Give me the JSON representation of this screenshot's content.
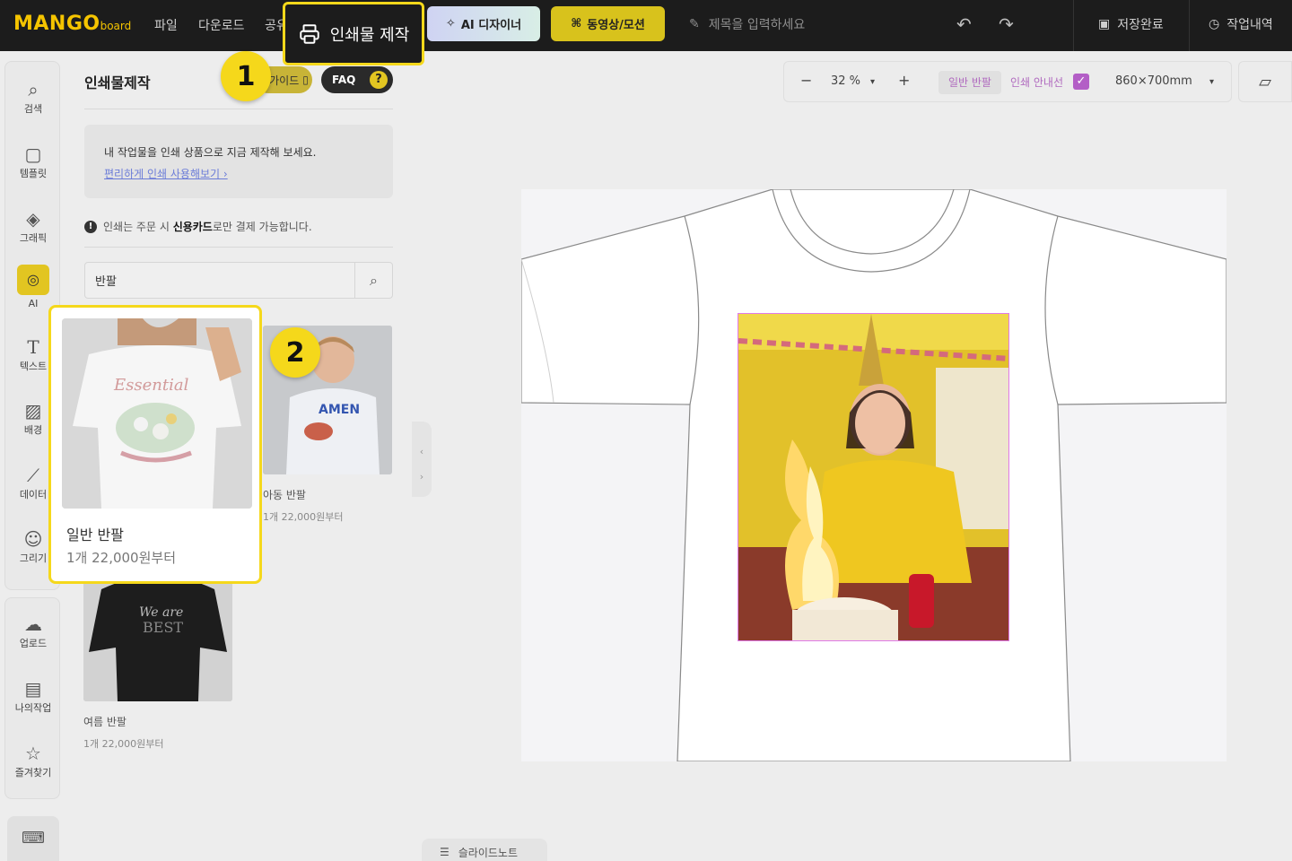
{
  "app": {
    "logo_main": "MANGO",
    "logo_sub": "board"
  },
  "topbar": {
    "menu": [
      "파일",
      "다운로드",
      "공유"
    ],
    "print_label": "인쇄물 제작",
    "ai_label": "AI 디자이너",
    "video_label": "동영상/모션",
    "title_placeholder": "제목을 입력하세요",
    "save_label": "저장완료",
    "history_label": "작업내역"
  },
  "rail": {
    "items": [
      "검색",
      "템플릿",
      "그래픽",
      "AI",
      "텍스트",
      "배경",
      "데이터",
      "그리기"
    ],
    "items2": [
      "업로드",
      "나의작업",
      "즐겨찾기"
    ]
  },
  "panel": {
    "title": "인쇄물제작",
    "guide_label": "가이드",
    "faq_label": "FAQ",
    "info_text": "내 작업물을 인쇄 상품으로 지금 제작해 보세요.",
    "info_link": "편리하게 인쇄 사용해보기 ›",
    "notice_prefix": "인쇄는 주문 시 ",
    "notice_bold": "신용카드",
    "notice_suffix": "로만 결제 가능합니다.",
    "search_value": "반팔",
    "products": [
      {
        "name": "일반 반팔",
        "price": "1개 22,000원부터"
      },
      {
        "name": "아동 반팔",
        "price": "1개 22,000원부터"
      },
      {
        "name": "여름 반팔",
        "price": "1개 22,000원부터"
      }
    ]
  },
  "callouts": {
    "step1": "1",
    "step2": "2"
  },
  "canvas_toolbar": {
    "zoom": "32 %",
    "product_type": "일반 반팔",
    "guide_label": "인쇄 안내선",
    "size": "860×700mm"
  },
  "footer": {
    "slide_note": "슬라이드노트"
  },
  "colors": {
    "accent_yellow": "#f5d81b",
    "topbar_bg": "#1c1c1c",
    "guide_purple": "#b35ec6"
  }
}
